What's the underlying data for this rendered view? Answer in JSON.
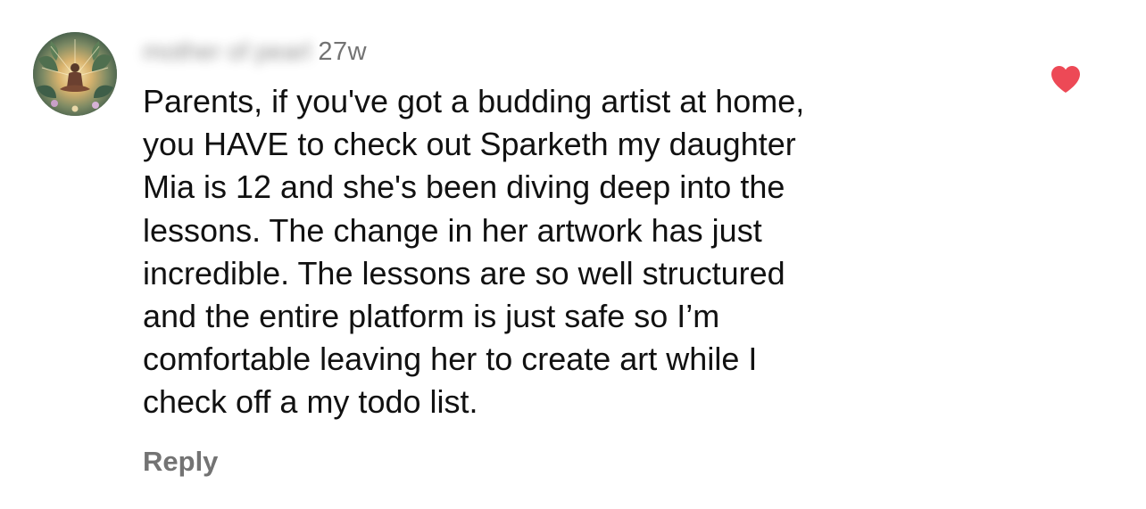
{
  "comment": {
    "username": "mother of pearl",
    "timestamp": "27w",
    "liked": true,
    "like_color": "#ed4956",
    "lines": [
      "Parents, if you've got a budding artist at home,",
      "you HAVE to check out Sparketh my daughter",
      "Mia is 12 and she's been diving deep into the",
      "lessons. The change in her artwork has just",
      "incredible. The lessons are so well structured",
      "and the entire platform is just safe so I’m",
      "comfortable leaving her to create art while I",
      "check off a my todo list."
    ],
    "reply_label": "Reply",
    "avatar_icon": "meditating-figure-avatar",
    "like_icon": "heart-icon"
  }
}
